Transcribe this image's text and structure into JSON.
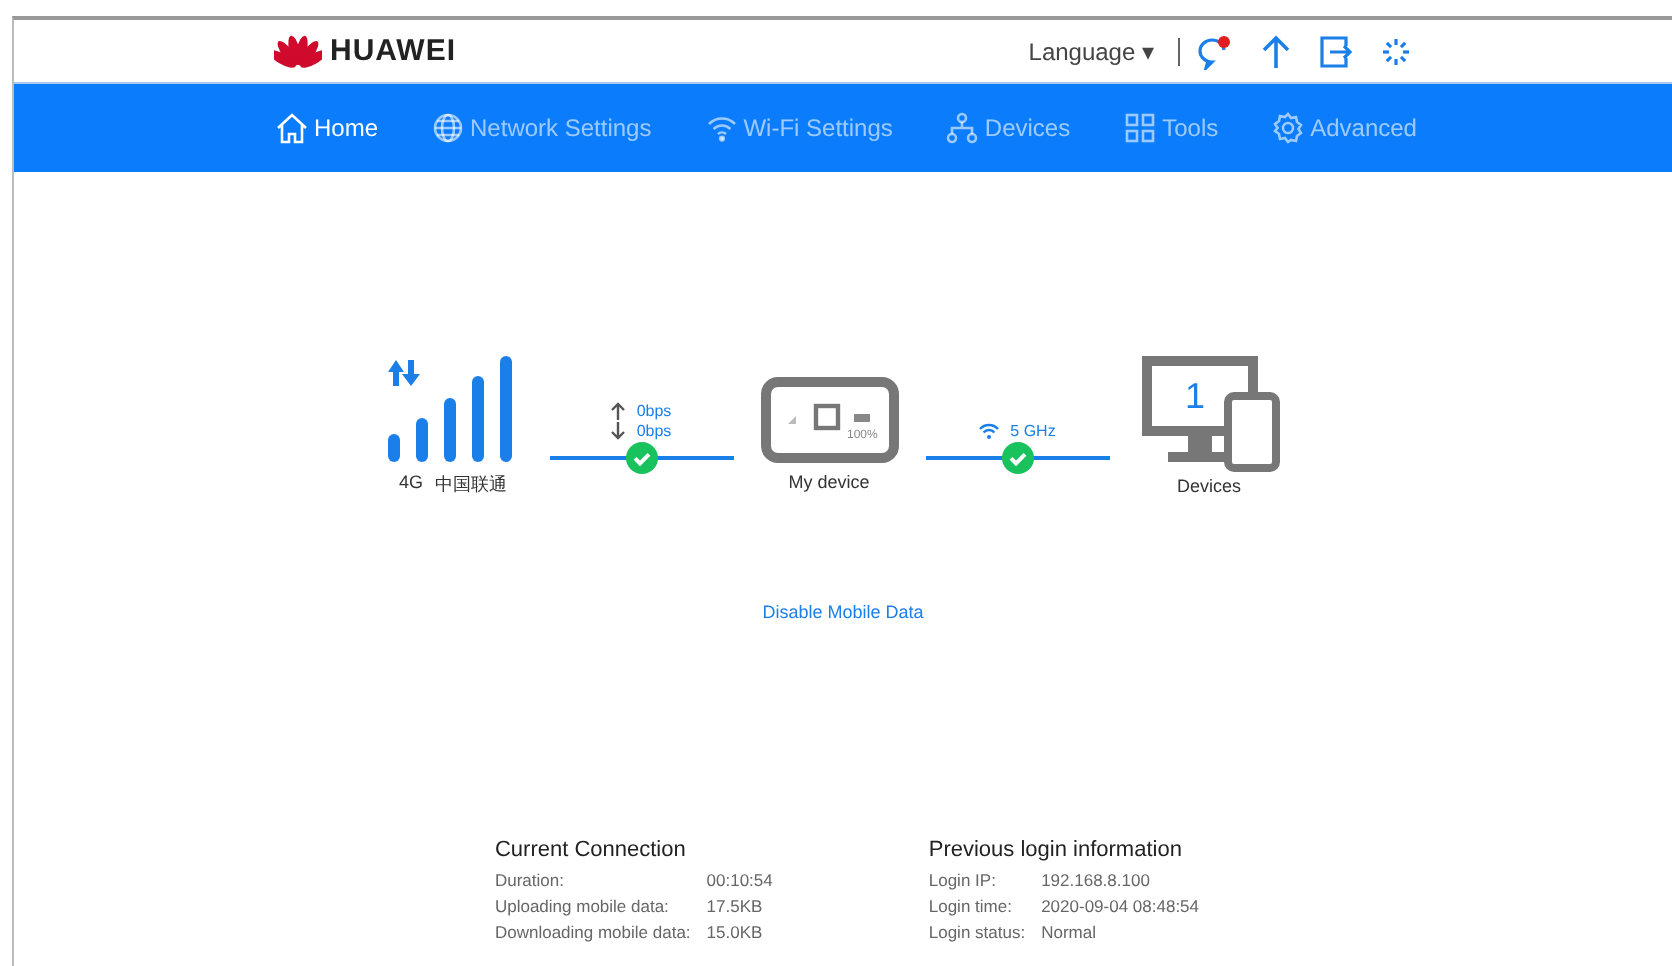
{
  "header": {
    "brand": "HUAWEI",
    "language": "Language ▾",
    "message_unread": true
  },
  "nav": [
    {
      "label": "Home",
      "selected": true
    },
    {
      "label": "Network Settings",
      "selected": false
    },
    {
      "label": "Wi-Fi Settings",
      "selected": false
    },
    {
      "label": "Devices",
      "selected": false
    },
    {
      "label": "Tools",
      "selected": false
    },
    {
      "label": "Advanced",
      "selected": false
    }
  ],
  "status": {
    "network": "4G",
    "operator": "中国联通",
    "mobile_link": {
      "upload": "0bps",
      "download": "0bps",
      "connected": true
    },
    "router": {
      "label": "My device",
      "battery": "100%"
    },
    "wifi_link": {
      "band": "5 GHz",
      "connected": true
    },
    "devices": {
      "count": "1",
      "label": "Devices"
    },
    "action": "Disable Mobile Data"
  },
  "current_connection": {
    "title": "Current Connection",
    "rows": [
      {
        "label": "Duration:",
        "value": "00:10:54"
      },
      {
        "label": "Uploading mobile data:",
        "value": "17.5KB"
      },
      {
        "label": "Downloading mobile data:",
        "value": "15.0KB"
      }
    ]
  },
  "previous_login": {
    "title": "Previous login information",
    "rows": [
      {
        "label": "Login IP:",
        "value": "192.168.8.100"
      },
      {
        "label": "Login time:",
        "value": "2020-09-04 08:48:54"
      },
      {
        "label": "Login status:",
        "value": "Normal"
      }
    ]
  }
}
